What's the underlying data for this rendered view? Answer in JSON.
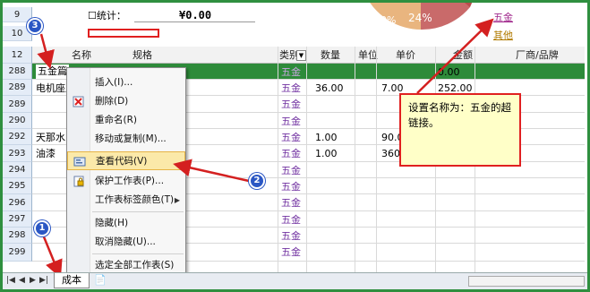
{
  "top": {
    "stat_label": "☐统计：",
    "stat_value": "¥0.00",
    "row_9": "9",
    "row_10": "10"
  },
  "pie": {
    "label_0": "0%",
    "label_24": "24%",
    "legend_1": "五金",
    "legend_2": "其他"
  },
  "columns": {
    "row12": "12",
    "name": "名称",
    "spec": "规格",
    "category": "类别",
    "qty": "数量",
    "unit": "单位",
    "price": "单价",
    "amount": "金额",
    "vendor": "厂商/品牌"
  },
  "rows": [
    {
      "num": "288",
      "name": "五金篇",
      "category": "五金",
      "qty": "",
      "price": "",
      "amount": "0.00"
    },
    {
      "num": "289",
      "name": "电机座及",
      "category": "五金",
      "qty": "36.00",
      "price": "7.00",
      "amount": "252.00"
    },
    {
      "num": "289",
      "name": "",
      "category": "五金",
      "qty": "",
      "price": "",
      "amount": ""
    },
    {
      "num": "290",
      "name": "",
      "category": "五金",
      "qty": "",
      "price": "",
      "amount": ""
    },
    {
      "num": "292",
      "name": "天那水",
      "category": "五金",
      "qty": "1.00",
      "price": "90.00",
      "amount": ""
    },
    {
      "num": "293",
      "name": "油漆",
      "category": "五金",
      "qty": "1.00",
      "price": "360",
      "amount": ""
    },
    {
      "num": "294",
      "name": "",
      "category": "五金",
      "qty": "",
      "price": "",
      "amount": ""
    },
    {
      "num": "295",
      "name": "",
      "category": "五金",
      "qty": "",
      "price": "",
      "amount": ""
    },
    {
      "num": "296",
      "name": "",
      "category": "五金",
      "qty": "",
      "price": "",
      "amount": ""
    },
    {
      "num": "297",
      "name": "",
      "category": "五金",
      "qty": "",
      "price": "",
      "amount": ""
    },
    {
      "num": "298",
      "name": "",
      "category": "五金",
      "qty": "",
      "price": "",
      "amount": ""
    },
    {
      "num": "299",
      "name": "",
      "category": "五金",
      "qty": "",
      "price": "",
      "amount": ""
    }
  ],
  "context_menu": {
    "insert": "插入(I)...",
    "delete": "删除(D)",
    "rename": "重命名(R)",
    "move_copy": "移动或复制(M)...",
    "view_code": "查看代码(V)",
    "protect": "保护工作表(P)...",
    "tab_color": "工作表标签颜色(T)",
    "hide": "隐藏(H)",
    "unhide": "取消隐藏(U)...",
    "select_all": "选定全部工作表(S)"
  },
  "callout": {
    "text": "设置名称为：五金的超链接。"
  },
  "badges": {
    "b1": "1",
    "b2": "2",
    "b3": "3"
  },
  "tabs": {
    "sheet_name": "成本"
  },
  "colors": {
    "frame": "#2f8f3f",
    "selected_row": "#2e8b3a",
    "callout_border": "#e02020",
    "callout_fill": "#ffffc8",
    "category_text": "#7030a0",
    "badge": "#2b57c4",
    "arrow": "#d42020"
  }
}
